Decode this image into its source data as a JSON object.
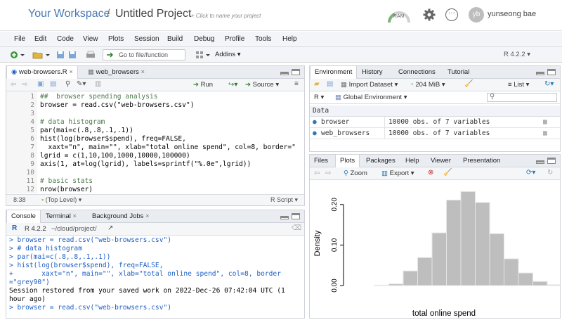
{
  "topbar": {
    "workspace": "Your Workspace",
    "separator": "/",
    "project": "Untitled Project",
    "project_hint": "+ Click to name your project",
    "ram_label": "RAM",
    "avatar_initials": "yb",
    "username": "yunseong bae"
  },
  "menu": [
    "File",
    "Edit",
    "Code",
    "View",
    "Plots",
    "Session",
    "Build",
    "Debug",
    "Profile",
    "Tools",
    "Help"
  ],
  "toolbar": {
    "goto_label": "Go to file/function",
    "addins_label": "Addins",
    "r_version": "R 4.2.2"
  },
  "editor": {
    "tabs": [
      "web-browsers.R",
      "web_browsers"
    ],
    "run_label": "Run",
    "source_label": "Source",
    "lines": [
      {
        "n": "1",
        "text": "##  browser spending analysis"
      },
      {
        "n": "2",
        "text": "browser = read.csv(\"web-browsers.csv\")"
      },
      {
        "n": "3",
        "text": ""
      },
      {
        "n": "4",
        "text": "# data histogram"
      },
      {
        "n": "5",
        "text": "par(mai=c(.8,.8,.1,.1))"
      },
      {
        "n": "6",
        "text": "hist(log(browser$spend), freq=FALSE,"
      },
      {
        "n": "7",
        "text": "  xaxt=\"n\", main=\"\", xlab=\"total online spend\", col=8, border=\""
      },
      {
        "n": "8",
        "text": "lgrid = c(1,10,100,1000,10000,100000)"
      },
      {
        "n": "9",
        "text": "axis(1, at=log(lgrid), labels=sprintf(\"%.0e\",lgrid))"
      },
      {
        "n": "10",
        "text": ""
      },
      {
        "n": "11",
        "text": "# basic stats"
      },
      {
        "n": "12",
        "text": "nrow(browser)"
      }
    ],
    "status_pos": "8:38",
    "status_scope": "(Top Level)",
    "status_lang": "R Script"
  },
  "console": {
    "tabs": [
      "Console",
      "Terminal",
      "Background Jobs"
    ],
    "r_version": "R 4.2.2",
    "path": "~/cloud/project/",
    "lines": [
      {
        "kind": "in",
        "text": "> browser = read.csv(\"web-browsers.csv\")"
      },
      {
        "kind": "in",
        "text": "> # data histogram"
      },
      {
        "kind": "in",
        "text": "> par(mai=c(.8,.8,.1,.1))"
      },
      {
        "kind": "in",
        "text": "> hist(log(browser$spend), freq=FALSE,"
      },
      {
        "kind": "in",
        "text": "+       xaxt=\"n\", main=\"\", xlab=\"total online spend\", col=8, border"
      },
      {
        "kind": "in",
        "text": "=\"grey90\")"
      },
      {
        "kind": "out",
        "text": "Session restored from your saved work on 2022-Dec-26 07:42:04 UTC (1"
      },
      {
        "kind": "out",
        "text": "hour ago)"
      },
      {
        "kind": "in",
        "text": "> browser = read.csv(\"web-browsers.csv\")"
      }
    ]
  },
  "environment": {
    "tabs": [
      "Environment",
      "History",
      "Connections",
      "Tutorial"
    ],
    "import_label": "Import Dataset",
    "mem_label": "204 MiB",
    "list_label": "List",
    "lang": "R",
    "scope": "Global Environment",
    "section": "Data",
    "rows": [
      {
        "name": "browser",
        "value": "10000 obs. of 7 variables"
      },
      {
        "name": "web_browsers",
        "value": "10000 obs. of 7 variables"
      }
    ]
  },
  "plots": {
    "tabs": [
      "Files",
      "Plots",
      "Packages",
      "Help",
      "Viewer",
      "Presentation"
    ],
    "zoom_label": "Zoom",
    "export_label": "Export",
    "colors": {
      "bar": "#bebebe",
      "border": "#e5e5e5"
    }
  },
  "chart_data": {
    "type": "bar",
    "title": "",
    "xlabel": "total online spend",
    "ylabel": "Density",
    "ylim": [
      0,
      0.25
    ],
    "yticks": [
      "0.00",
      "0.10",
      "0.20"
    ],
    "ytick_values": [
      0,
      0.1,
      0.2
    ],
    "bin_edges": [
      0,
      1,
      2,
      3,
      4,
      5,
      6,
      7,
      8,
      9,
      10,
      11,
      12,
      13
    ],
    "values": [
      0.001,
      0.004,
      0.036,
      0.069,
      0.13,
      0.211,
      0.232,
      0.205,
      0.128,
      0.066,
      0.031,
      0.01,
      0.002
    ],
    "grid": false
  }
}
